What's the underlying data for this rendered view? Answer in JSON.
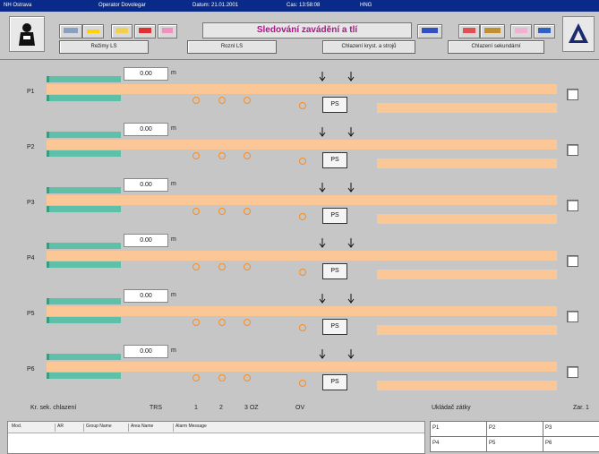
{
  "titlebar": {
    "app": "NH Ostrava",
    "operator": "Operator Dovolegar",
    "date": "Datum: 21.01.2001",
    "time": "Cas: 13:58:08",
    "code": "HNG"
  },
  "toolbar": {
    "screen_title": "Sledování zavádění a tlí",
    "nav_buttons": [
      "Režimy LS",
      "Roznl LS",
      "Chlazení kryst. a strojů",
      "Chlazení sekundární"
    ]
  },
  "rows": [
    {
      "label": "P1",
      "value": "0.00",
      "unit": "m",
      "ps": "PS"
    },
    {
      "label": "P2",
      "value": "0.00",
      "unit": "m",
      "ps": "PS"
    },
    {
      "label": "P3",
      "value": "0.00",
      "unit": "m",
      "ps": "PS"
    },
    {
      "label": "P4",
      "value": "0.00",
      "unit": "m",
      "ps": "PS"
    },
    {
      "label": "P5",
      "value": "0.00",
      "unit": "m",
      "ps": "PS"
    },
    {
      "label": "P6",
      "value": "0.00",
      "unit": "m",
      "ps": "PS"
    }
  ],
  "legend": {
    "kr": "Kr. sek. chlazení",
    "trs": "TRS",
    "n1": "1",
    "n2": "2",
    "n3oz": "3 OZ",
    "ov": "OV",
    "save": "Ukládač zátky",
    "zar": "Zar. 1"
  },
  "alarm_table": {
    "columns": [
      "Mod.",
      "AR",
      "Group Name",
      "Area Name",
      "Alarm Message"
    ]
  },
  "p_grid": [
    "P1",
    "P2",
    "P3",
    "P4",
    "P5",
    "P6"
  ],
  "colors": {
    "accent_title": "#b0138a",
    "band": "#fbc797",
    "teal": "#5ec0a8",
    "dot": "#ff8c1a",
    "titlebar": "#0a2a8a"
  },
  "icons": [
    "logo-icon",
    "print-icon",
    "folder-icon",
    "alarm-icon",
    "trend-icon",
    "rewind-icon",
    "delete-icon",
    "key-icon",
    "mail-icon",
    "triangle-logo-icon",
    "arrow-down-icon"
  ]
}
